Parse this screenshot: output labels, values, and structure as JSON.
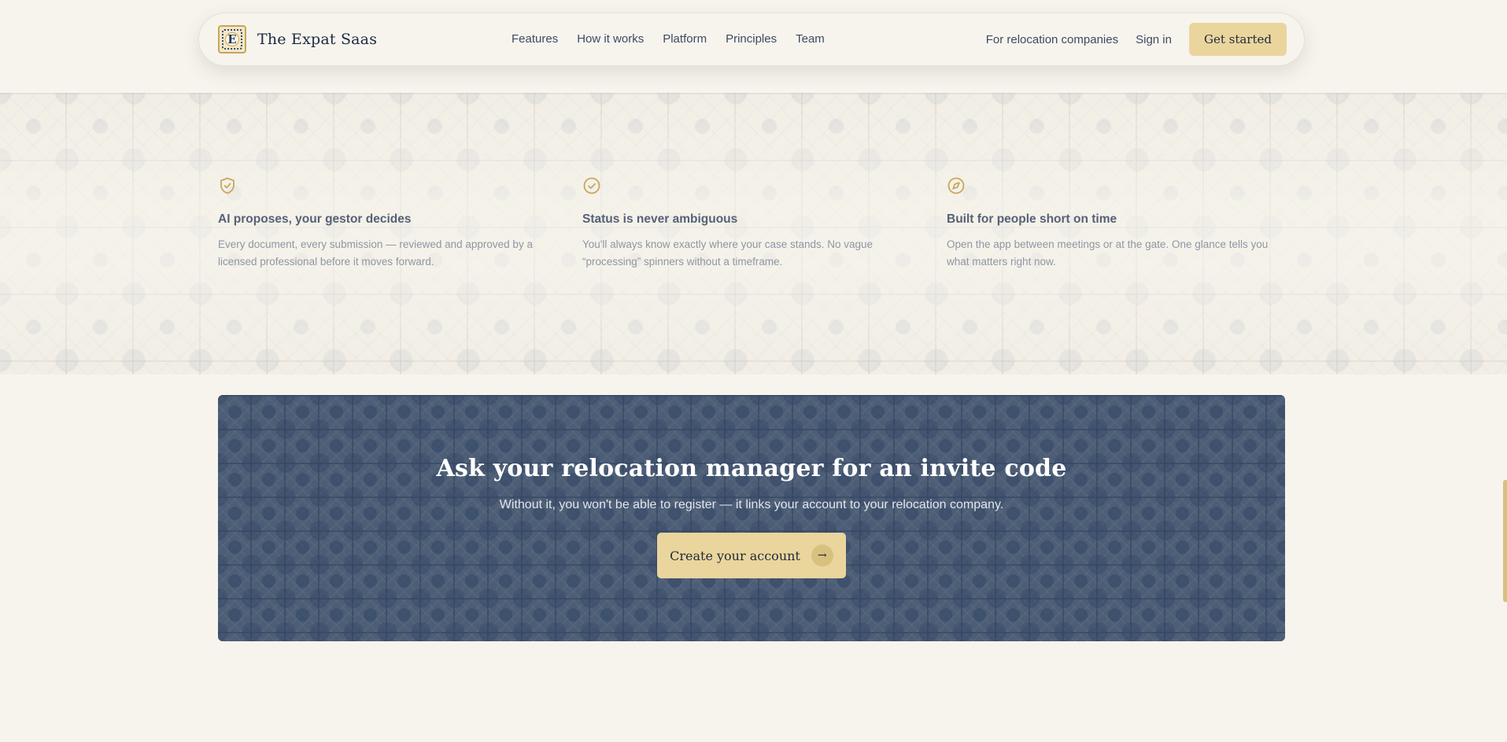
{
  "nav": {
    "logo_letter": "E",
    "brand": "The Expat Saas",
    "links": [
      "Features",
      "How it works",
      "Platform",
      "Principles",
      "Team"
    ],
    "for_companies": "For relocation companies",
    "sign_in": "Sign in",
    "get_started": "Get started"
  },
  "features": [
    {
      "icon": "shield-check-icon",
      "title": "AI proposes, your gestor decides",
      "desc": "Every document, every submission — reviewed and approved by a licensed professional before it moves forward."
    },
    {
      "icon": "circle-check-icon",
      "title": "Status is never ambiguous",
      "desc": "You'll always know exactly where your case stands. No vague “processing” spinners without a timeframe."
    },
    {
      "icon": "compass-icon",
      "title": "Built for people short on time",
      "desc": "Open the app between meetings or at the gate. One glance tells you what matters right now."
    }
  ],
  "cta": {
    "title": "Ask your relocation manager for an invite code",
    "subtitle": "Without it, you won't be able to register — it links your account to your relocation company.",
    "button": "Create your account",
    "button_icon": "arrow-right-icon"
  },
  "colors": {
    "accent": "#ead59d",
    "icon": "#c9a65b",
    "cta_bg": "#4a5b72"
  }
}
